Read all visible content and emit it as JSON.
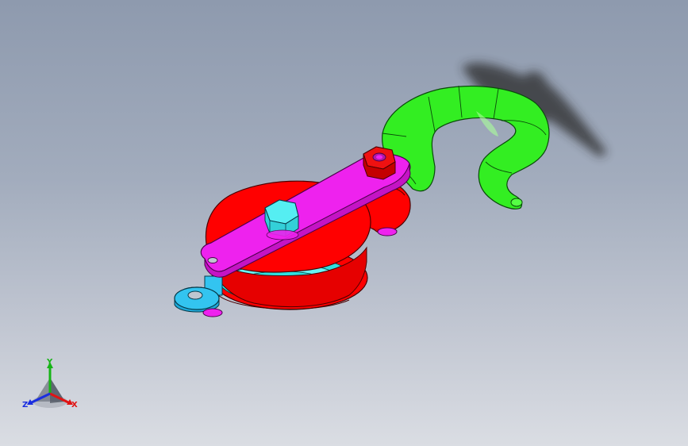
{
  "viewport": {
    "background_top": "#8e9aae",
    "background_bottom": "#dadde3"
  },
  "model": {
    "parts": [
      {
        "name": "hook",
        "color": "#33ee22"
      },
      {
        "name": "pulley-body",
        "color": "#ff0000"
      },
      {
        "name": "sheave",
        "color": "#33e8e8"
      },
      {
        "name": "link-plate",
        "color": "#ee22ee"
      },
      {
        "name": "nut-center",
        "color": "#55eef2"
      },
      {
        "name": "nut-top",
        "color": "#ee1111"
      },
      {
        "name": "eye-ring",
        "color": "#33c4f0"
      }
    ]
  },
  "triad": {
    "x_label": "X",
    "y_label": "Y",
    "z_label": "Z",
    "x_color": "#e01414",
    "y_color": "#16b416",
    "z_color": "#1a2ee0"
  }
}
